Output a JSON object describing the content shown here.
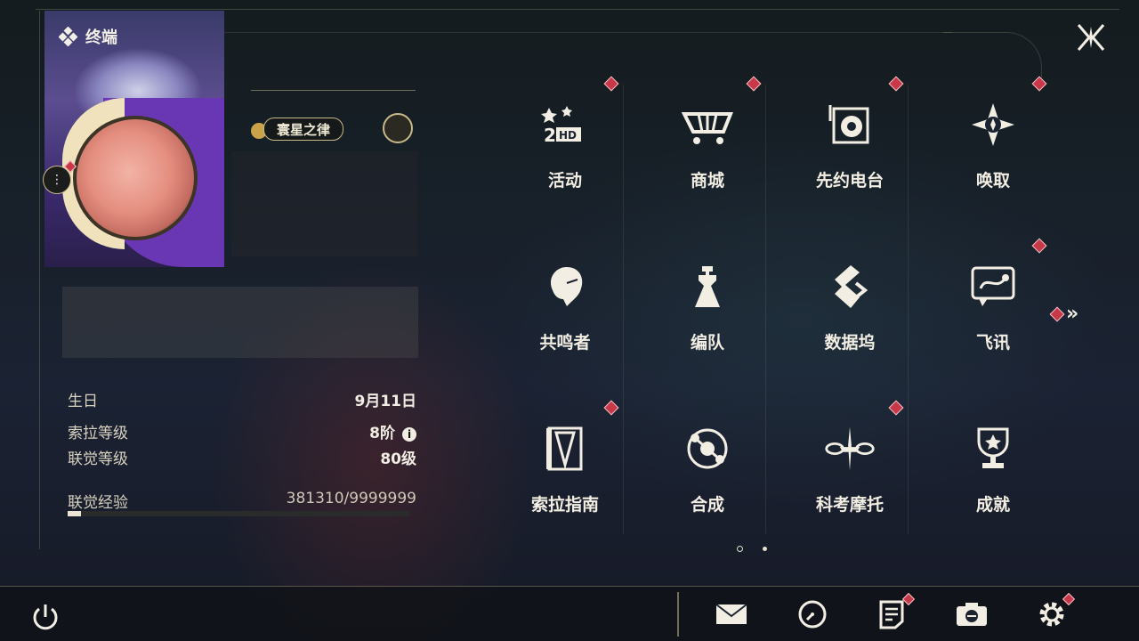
{
  "profile": {
    "section_title": "终端",
    "title_plate": "寰星之律",
    "stats": [
      {
        "key": "生日",
        "value": "9月11日"
      },
      {
        "key": "索拉等级",
        "value": "8阶"
      },
      {
        "key": "联觉等级",
        "value": "80级"
      },
      {
        "key": "联觉经验",
        "value": "381310/9999999"
      }
    ],
    "xp_fraction": 0.038
  },
  "menu": {
    "page1": [
      {
        "label": "活动",
        "icon": "event-2hd-icon",
        "badge": true
      },
      {
        "label": "商城",
        "icon": "shop-icon",
        "badge": true
      },
      {
        "label": "先约电台",
        "icon": "radio-icon",
        "badge": true
      },
      {
        "label": "唤取",
        "icon": "convene-icon",
        "badge": true
      },
      {
        "label": "共鸣者",
        "icon": "resonator-icon",
        "badge": false
      },
      {
        "label": "编队",
        "icon": "team-icon",
        "badge": false
      },
      {
        "label": "数据坞",
        "icon": "data-bank-icon",
        "badge": false
      },
      {
        "label": "飞讯",
        "icon": "message-icon",
        "badge": true
      },
      {
        "label": "索拉指南",
        "icon": "guidebook-icon",
        "badge": true
      },
      {
        "label": "合成",
        "icon": "synthesis-icon",
        "badge": false
      },
      {
        "label": "科考摩托",
        "icon": "motorbike-icon",
        "badge": true
      },
      {
        "label": "成就",
        "icon": "achievement-icon",
        "badge": false
      }
    ],
    "page_count": 2,
    "current_page": 1
  },
  "bottom_bar": {
    "icons": [
      "mail-icon",
      "clock-icon",
      "notes-icon",
      "camera-icon",
      "settings-icon"
    ]
  },
  "colors": {
    "badge_red": "#c73848",
    "accent_gold": "#c9b88a",
    "text_light": "#f2eee3"
  }
}
